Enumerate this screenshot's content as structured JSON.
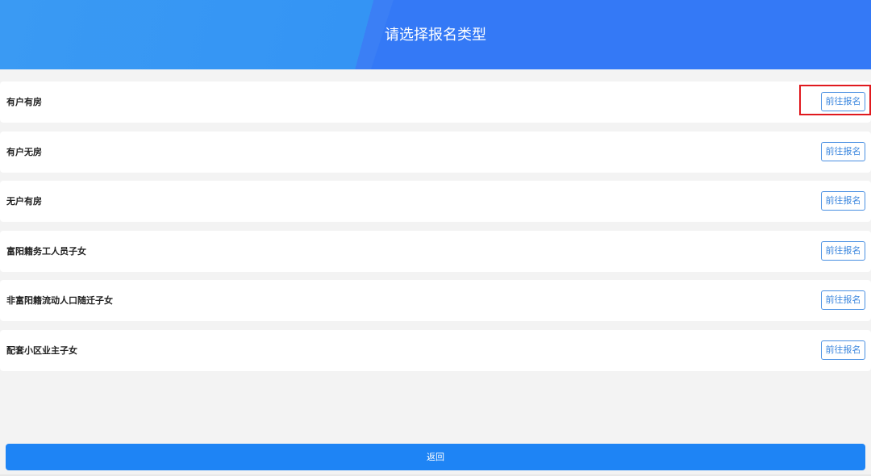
{
  "header": {
    "title": "请选择报名类型"
  },
  "rows": [
    {
      "label": "有户有房",
      "button": "前往报名"
    },
    {
      "label": "有户无房",
      "button": "前往报名"
    },
    {
      "label": "无户有房",
      "button": "前往报名"
    },
    {
      "label": "富阳籍务工人员子女",
      "button": "前往报名"
    },
    {
      "label": "非富阳籍流动人口随迁子女",
      "button": "前往报名"
    },
    {
      "label": "配套小区业主子女",
      "button": "前往报名"
    }
  ],
  "footer": {
    "back_label": "返回"
  },
  "colors": {
    "header_left": "#3a9af3",
    "header_right": "#3479f6",
    "button_border": "#4a90e2",
    "back_button": "#1e84f5",
    "highlight": "#e0191e"
  }
}
